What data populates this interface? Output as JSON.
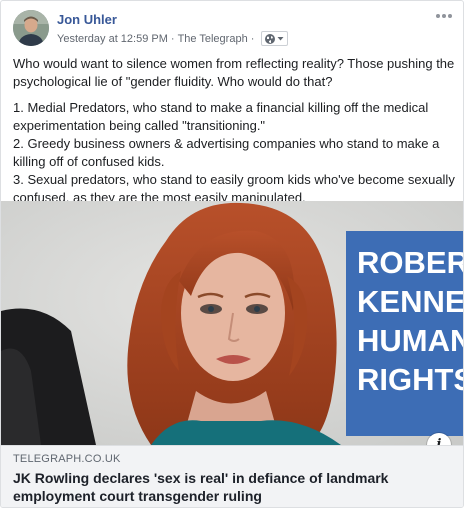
{
  "post": {
    "author": "Jon Uhler",
    "timestamp": "Yesterday at 12:59 PM",
    "separator": "·",
    "via": "The Telegraph",
    "separator2": "·",
    "audience_icon": "globe-icon",
    "more_icon": "more-options-icon",
    "text_intro": "Who would want to silence women from reflecting reality? Those pushing the psychological lie of \"gender fluidity. Who would do that?",
    "text_items": [
      "1. Medial Predators, who stand to make a financial killing off the medical experimentation being called \"transitioning.\"",
      "2. Greedy business owners & advertising companies who stand to make a killing off of confused kids.",
      "3. Sexual predators, who stand to easily groom kids who've become sexually confused, as they are the most easily manipulated."
    ]
  },
  "link": {
    "photo_sign_lines": [
      "ROBERT",
      "KENNEDY",
      "HUMAN",
      "RIGHTS"
    ],
    "info_label": "i",
    "domain": "TELEGRAPH.CO.UK",
    "headline": "JK Rowling declares 'sex is real' in defiance of landmark employment court transgender ruling"
  },
  "colors": {
    "author": "#385898",
    "link_bg": "#f2f3f5",
    "sign_blue": "#3d6db5"
  }
}
